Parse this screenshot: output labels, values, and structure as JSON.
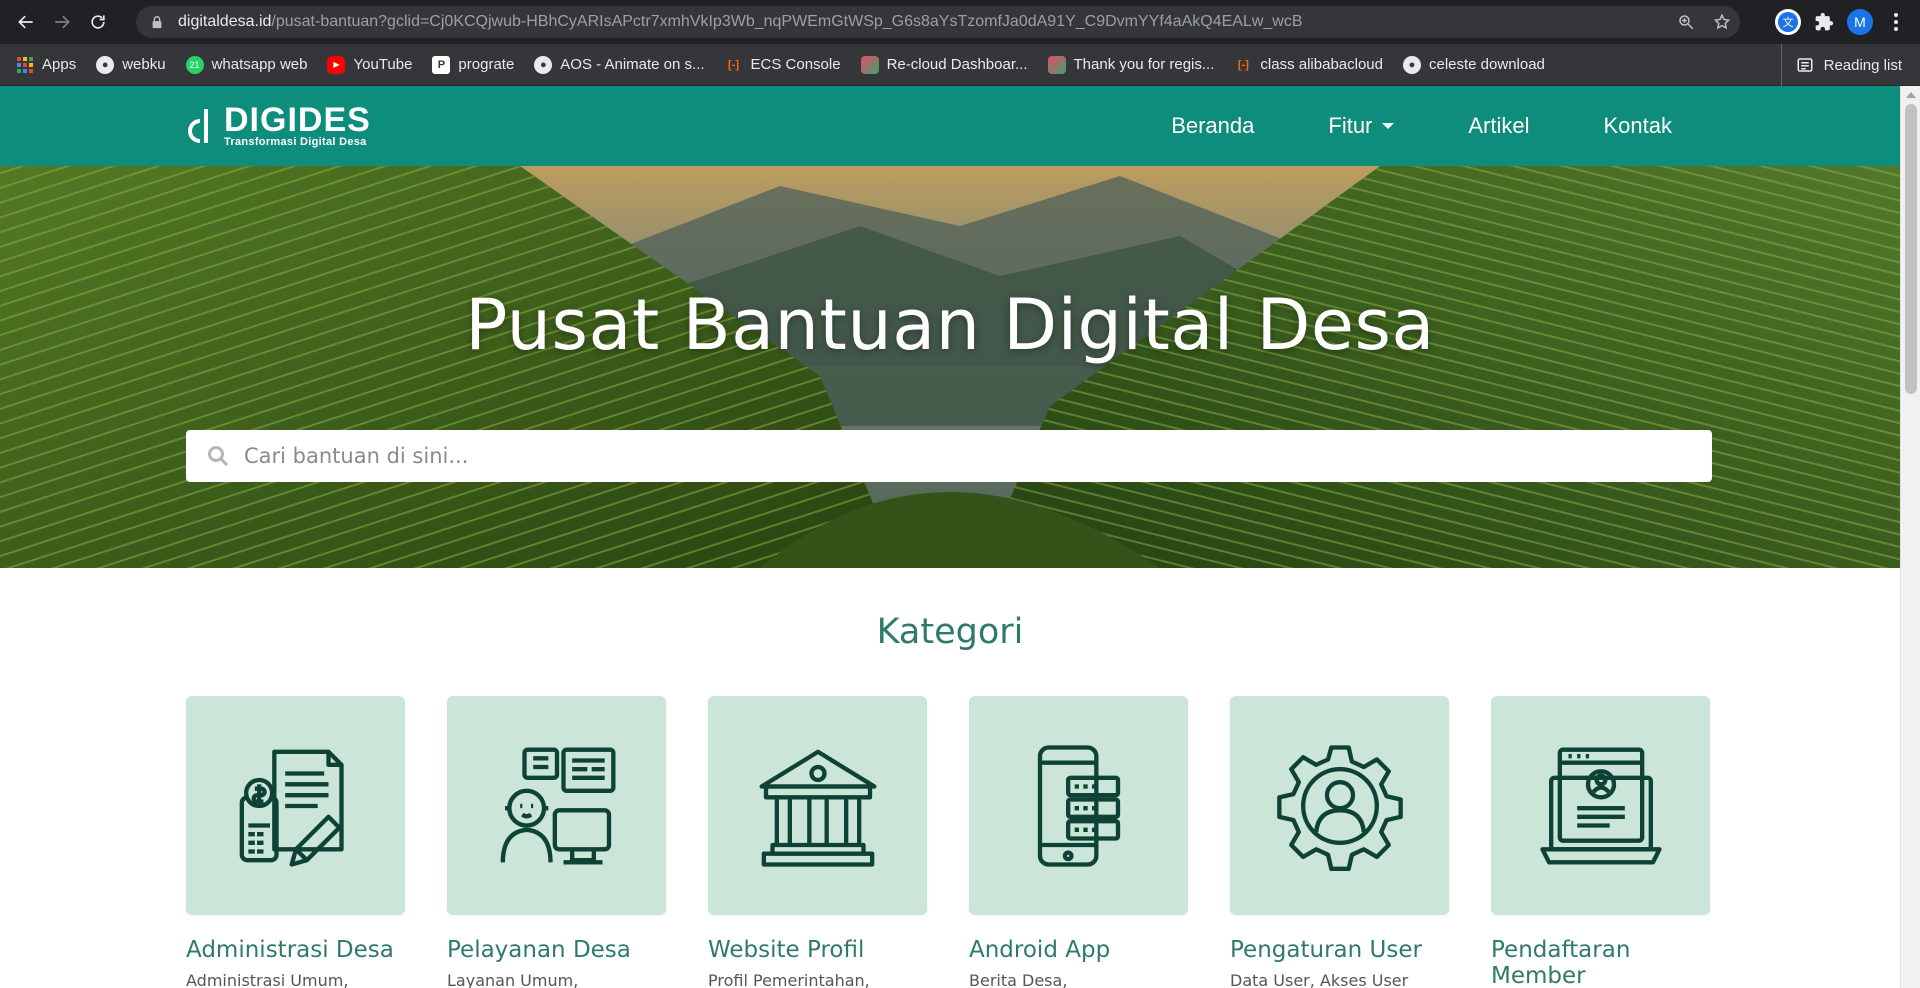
{
  "browser": {
    "url_host": "digitaldesa.id",
    "url_path": "/pusat-bantuan?gclid=Cj0KCQjwub-HBhCyARIsAPctr7xmhVkIp3Wb_nqPWEmGtWSp_G6s8aYsTzomfJa0dA91Y_C9DvmYYf4aAkQ4EALw_wcB",
    "profile_initial": "M",
    "bookmarks": [
      {
        "label": "Apps"
      },
      {
        "label": "webku"
      },
      {
        "label": "whatsapp web"
      },
      {
        "label": "YouTube"
      },
      {
        "label": "prograte"
      },
      {
        "label": "AOS - Animate on s..."
      },
      {
        "label": "ECS Console"
      },
      {
        "label": "Re-cloud Dashboar..."
      },
      {
        "label": "Thank you for regis..."
      },
      {
        "label": "class alibabacloud"
      },
      {
        "label": "celeste download"
      }
    ],
    "reading_list": "Reading list"
  },
  "site": {
    "logo_title": "DIGIDES",
    "logo_subtitle": "Transformasi Digital Desa",
    "menu": {
      "home": "Beranda",
      "features": "Fitur",
      "articles": "Artikel",
      "contact": "Kontak"
    },
    "brand_color": "#0e8c7c"
  },
  "hero": {
    "title": "Pusat Bantuan Digital Desa",
    "search_placeholder": "Cari bantuan di sini..."
  },
  "kategori": {
    "heading": "Kategori",
    "cards": [
      {
        "title": "Administrasi Desa",
        "desc": "Administrasi Umum,",
        "icon": "document-money-icon"
      },
      {
        "title": "Pelayanan Desa",
        "desc": "Layanan Umum,",
        "icon": "customer-service-icon"
      },
      {
        "title": "Website Profil",
        "desc": "Profil Pemerintahan,",
        "icon": "government-building-icon"
      },
      {
        "title": "Android App",
        "desc": "Berita Desa,",
        "icon": "mobile-app-icon"
      },
      {
        "title": "Pengaturan User",
        "desc": "Data User, Akses User",
        "icon": "user-settings-icon"
      },
      {
        "title": "Pendaftaran Member",
        "desc": "",
        "icon": "laptop-profile-icon"
      }
    ]
  }
}
